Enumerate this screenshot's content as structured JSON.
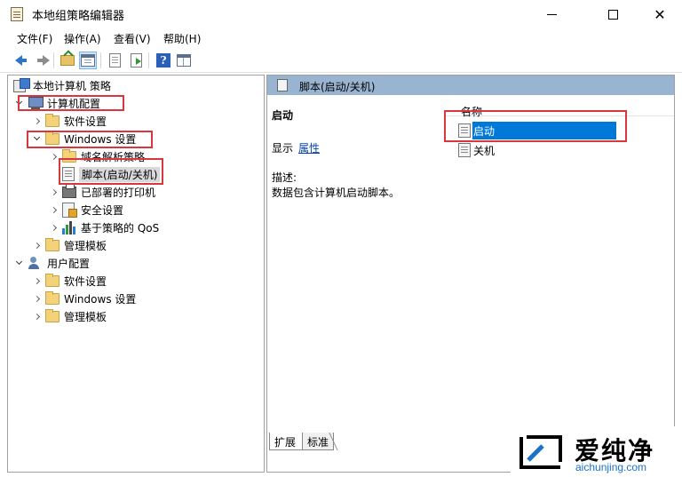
{
  "window": {
    "title": "本地组策略编辑器",
    "min_symbol": "",
    "max_symbol": "",
    "close_symbol": "✕"
  },
  "menu": [
    {
      "label": "文件(F)"
    },
    {
      "label": "操作(A)"
    },
    {
      "label": "查看(V)"
    },
    {
      "label": "帮助(H)"
    }
  ],
  "toolbar": {
    "icons": [
      "back-arrow-icon",
      "forward-arrow-icon",
      "folder-up-icon",
      "show-hide-tree-icon",
      "properties-icon",
      "export-list-icon",
      "help-icon",
      "extended-view-icon"
    ],
    "help_glyph": "?"
  },
  "tree": {
    "root": "本地计算机 策略",
    "computer_config": "计算机配置",
    "software_settings": "软件设置",
    "windows_settings": "Windows 设置",
    "dns_policy": "域名解析策略",
    "scripts": "脚本(启动/关机)",
    "deployed_printers": "已部署的打印机",
    "security_settings": "安全设置",
    "qos": "基于策略的 QoS",
    "admin_templates": "管理模板",
    "user_config": "用户配置",
    "user_software_settings": "软件设置",
    "user_windows_settings": "Windows 设置",
    "user_admin_templates": "管理模板"
  },
  "details": {
    "header_title": "脚本(启动/关机)",
    "item_name": "启动",
    "show_label": "显示",
    "properties_link": "属性",
    "description_label": "描述:",
    "description_text": "数据包含计算机启动脚本。",
    "column_name": "名称",
    "items": [
      {
        "label": "启动",
        "selected": true
      },
      {
        "label": "关机",
        "selected": false
      }
    ]
  },
  "tabs": [
    {
      "label": "扩展"
    },
    {
      "label": "标准"
    }
  ],
  "logo": {
    "cn": "爱纯净",
    "en": "aichunjing.com"
  },
  "colors": {
    "highlight_red": "#d9363e",
    "selection_blue": "#0078d7",
    "header_blue": "#99b4d1",
    "link_blue": "#0645ad"
  }
}
